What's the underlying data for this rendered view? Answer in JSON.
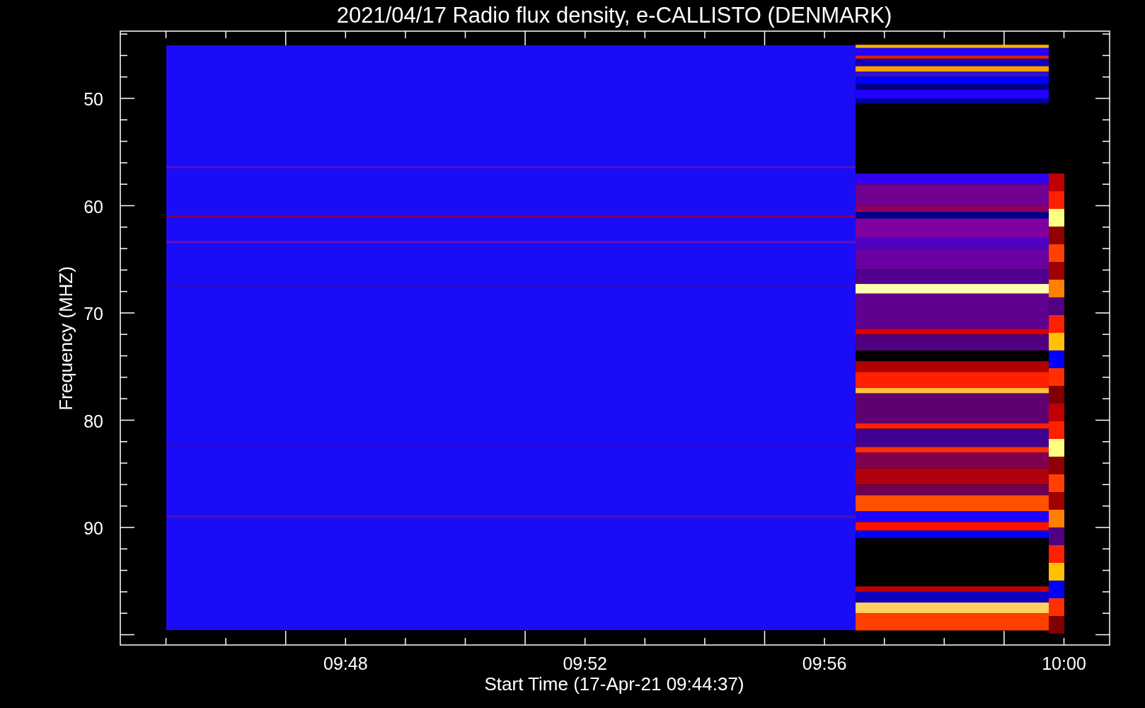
{
  "title": "2021/04/17  Radio flux density, e-CALLISTO (DENMARK)",
  "y_axis": {
    "label": "Frequency (MHZ)",
    "ticks": [
      "50",
      "60",
      "70",
      "80",
      "90"
    ]
  },
  "x_axis": {
    "label": "Start Time (17-Apr-21 09:44:37)",
    "ticks": [
      "09:48",
      "09:52",
      "09:56",
      "10:00"
    ]
  }
}
